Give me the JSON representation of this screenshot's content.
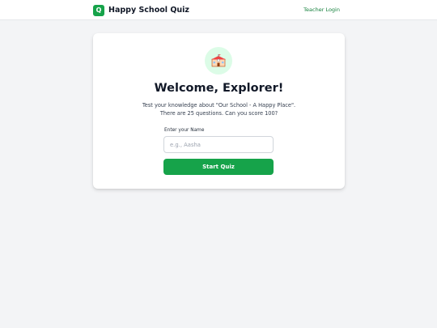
{
  "header": {
    "logo_letter": "Q",
    "app_name": "Happy School Quiz",
    "teacher_login": "Teacher Login"
  },
  "card": {
    "icon": "school-building-icon",
    "icon_glyph": "🏫",
    "title": "Welcome, Explorer!",
    "description_line1": "Test your knowledge about \"Our School - A Happy Place\".",
    "description_line2": "There are 25 questions. Can you score 100?",
    "name_label": "Enter your Name",
    "name_placeholder": "e.g., Aasha",
    "name_value": "",
    "start_button": "Start Quiz"
  },
  "colors": {
    "accent": "#16a34a",
    "accent_light": "#dcfce7",
    "background": "#f3f4f6",
    "link": "#15803d"
  }
}
